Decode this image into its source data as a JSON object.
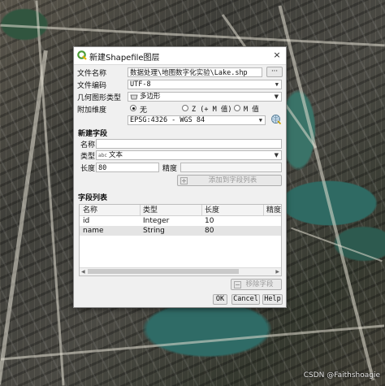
{
  "dialog": {
    "title": "新建Shapefile图层",
    "close_glyph": "×"
  },
  "form": {
    "file_name_label": "文件名称",
    "file_name_value": "数据处理\\地图数字化实验\\Lake.shp",
    "browse_glyph": "···",
    "file_encoding_label": "文件编码",
    "file_encoding_value": "UTF-8",
    "geometry_type_label": "几何图形类型",
    "geometry_type_value": "多边形",
    "extra_dimension_label": "附加维度",
    "dimension_options": [
      {
        "label": "无",
        "selected": true
      },
      {
        "label": "Z (+ M 值)",
        "selected": false
      },
      {
        "label": "M 值",
        "selected": false
      }
    ],
    "crs_value": "EPSG:4326 - WGS 84"
  },
  "new_field": {
    "section_title": "新建字段",
    "name_label": "名称",
    "name_value": "",
    "type_label": "类型",
    "type_icon_text": "abc",
    "type_value": "文本",
    "length_label": "长度",
    "length_value": "80",
    "precision_label": "精度",
    "precision_value": "",
    "add_button": "添加到字段列表"
  },
  "field_list": {
    "section_title": "字段列表",
    "columns": [
      "名称",
      "类型",
      "长度",
      "精度"
    ],
    "rows": [
      [
        "id",
        "Integer",
        "10",
        ""
      ],
      [
        "name",
        "String",
        "80",
        ""
      ]
    ],
    "remove_button": "移除字段"
  },
  "buttons": {
    "ok": "OK",
    "cancel": "Cancel",
    "help": "Help"
  },
  "watermark": "CSDN @Faithshoagie",
  "colors": {
    "qgis_green": "#4a9a37",
    "selected_row": "#e4e4e4"
  }
}
